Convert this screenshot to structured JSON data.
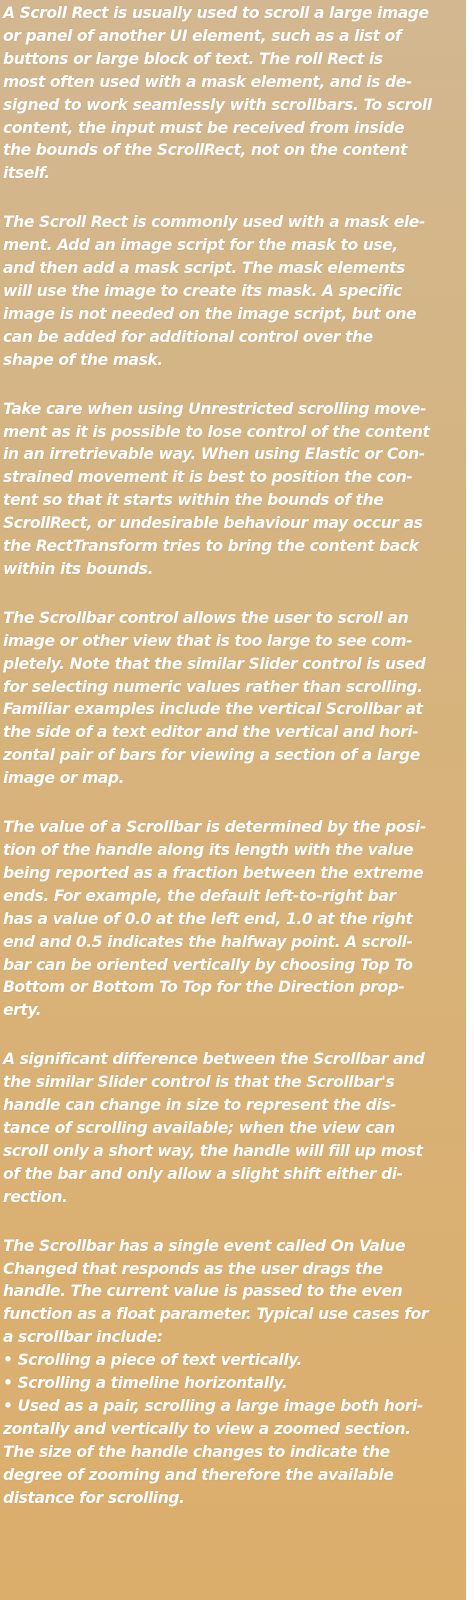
{
  "scroll_rect": {
    "paragraphs": [
      "A Scroll Rect is usually used to scroll a large image\nor panel of another UI element, such as a list of\nbuttons or large block of text. The  roll Rect is\nmost often used with a mask element, and is de-\nsigned to work seamlessly with scrollbars. To scroll\ncontent, the input must be received from inside\nthe bounds of the ScrollRect, not on the content\nitself.",
      "The Scroll Rect is commonly used with a mask ele-\nment. Add an image script for the mask to use,\nand then add a mask script. The mask elements\nwill use the image to create its mask. A specific\nimage is not needed on the image script, but one\ncan be added for additional control over the\nshape of the mask.",
      "Take care when using Unrestricted scrolling move-\nment as it is possible to lose control of the content\nin an irretrievable way. When using Elastic or Con-\nstrained movement it is best to position the con-\ntent so that it starts within the bounds of the\nScrollRect, or undesirable behaviour may occur as\nthe RectTransform tries to bring the content back\nwithin its bounds.",
      "The Scrollbar control allows the user to scroll an\nimage or other view that is too large to see com-\npletely. Note that the similar Slider control is used\nfor selecting numeric values rather than scrolling.\nFamiliar examples include the vertical Scrollbar at\nthe side of a text editor and the vertical and hori-\nzontal pair of bars for viewing a section of a large\nimage or map.",
      "The value of a Scrollbar is determined by the posi-\ntion of the handle along its length with the value\nbeing reported as a fraction between the extreme\nends. For example, the default left-to-right bar\nhas a value of 0.0 at the left end, 1.0 at the right\nend and 0.5 indicates the halfway point. A scroll-\nbar can be oriented vertically by choosing Top To\nBottom or Bottom To Top for the Direction prop-\nerty.",
      "A significant difference between the Scrollbar and\nthe similar Slider control is that the Scrollbar's\nhandle can change in size to represent the dis-\ntance of scrolling available; when the view can\nscroll only a short way, the handle will fill up most\nof the bar and only allow a slight shift either di-\nrection.",
      "The Scrollbar has a single event called On Value\nChanged that responds as the user drags the\nhandle. The current value is passed to the even\nfunction as a float parameter. Typical use cases for\na scrollbar include:\n• Scrolling a piece of text vertically.\n• Scrolling a timeline horizontally.\n• Used as a pair, scrolling a large image both hori-\nzontally and vertically to view a zoomed section.\nThe size of the handle changes to indicate the\ndegree of zooming and therefore the available\ndistance for scrolling."
    ]
  },
  "colors": {
    "panel_top": "#d2b790",
    "panel_bottom": "#dcae6c",
    "text": "#ffffff"
  }
}
